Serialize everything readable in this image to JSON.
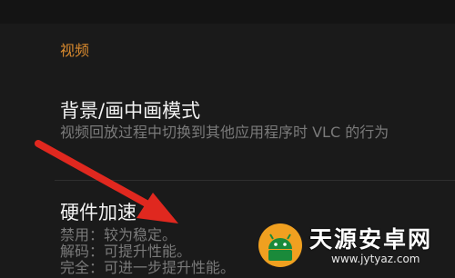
{
  "section": {
    "header": "视频"
  },
  "settings": [
    {
      "title": "背景/画中画模式",
      "description": "视频回放过程中切换到其他应用程序时 VLC 的行为"
    },
    {
      "title": "硬件加速",
      "description_lines": [
        "禁用：较为稳定。",
        "解码：可提升性能。",
        "完全：可进一步提升性能。"
      ]
    }
  ],
  "annotation": {
    "arrow_color": "#e0281f"
  },
  "watermark": {
    "name": "天源安卓网",
    "url": "www.jytyaz.com",
    "logo_colors": [
      "#f0a020",
      "#1a8a3a"
    ]
  },
  "colors": {
    "background": "#1a1a1a",
    "accent": "#d98a2e",
    "title_text": "#f2f2f2",
    "secondary_text": "#7a7a7a"
  }
}
